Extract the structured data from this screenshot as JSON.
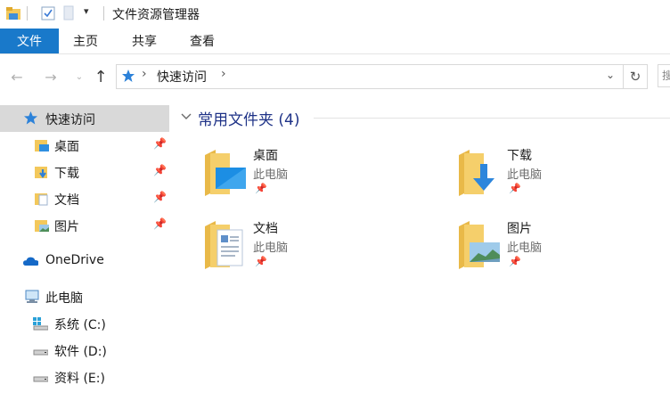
{
  "window": {
    "title": "文件资源管理器"
  },
  "ribbon": {
    "tabs": [
      "文件",
      "主页",
      "共享",
      "查看"
    ]
  },
  "address": {
    "location": "快速访问",
    "search_placeholder": "搜"
  },
  "sidebar": {
    "quick_access": "快速访问",
    "pinned": [
      "桌面",
      "下载",
      "文档",
      "图片"
    ],
    "onedrive": "OneDrive",
    "this_pc": "此电脑",
    "drives": [
      "系统 (C:)",
      "软件 (D:)",
      "资料 (E:)"
    ]
  },
  "content": {
    "group_title": "常用文件夹 (4)",
    "tiles": [
      {
        "name": "桌面",
        "location": "此电脑"
      },
      {
        "name": "下载",
        "location": "此电脑"
      },
      {
        "name": "文档",
        "location": "此电脑"
      },
      {
        "name": "图片",
        "location": "此电脑"
      }
    ]
  },
  "colors": {
    "accent": "#1979ca",
    "folder": "#f3c85b",
    "selection": "#d9d9d9",
    "group_title": "#1e3287"
  }
}
